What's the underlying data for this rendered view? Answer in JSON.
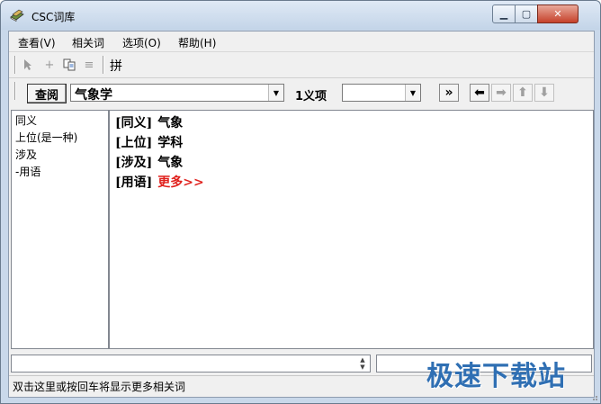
{
  "window": {
    "title": "CSC词库"
  },
  "menu": [
    "查看(V)",
    "相关词",
    "选项(O)",
    "帮助(H)"
  ],
  "toolbar": {
    "pinyin_label": "拼"
  },
  "lookup": {
    "button_label": "查阅",
    "query_value": "气象学",
    "sense_label": "1义项",
    "sense_value": ""
  },
  "nav": {
    "forward_label": "»"
  },
  "categories": [
    "同义",
    "上位(是一种)",
    "涉及",
    "-用语"
  ],
  "relations": [
    {
      "tag": "[同义]",
      "value": "气象",
      "style": "normal"
    },
    {
      "tag": "[上位]",
      "value": "学科",
      "style": "normal"
    },
    {
      "tag": "[涉及]",
      "value": "气象",
      "style": "normal"
    },
    {
      "tag": "[用语]",
      "value": "更多>>",
      "style": "more"
    }
  ],
  "status": {
    "text": "双击这里或按回车将显示更多相关词"
  },
  "watermark": {
    "text": "极速下载站"
  },
  "colors": {
    "more_link": "#e0201c",
    "watermark": "#2f6fb3"
  }
}
